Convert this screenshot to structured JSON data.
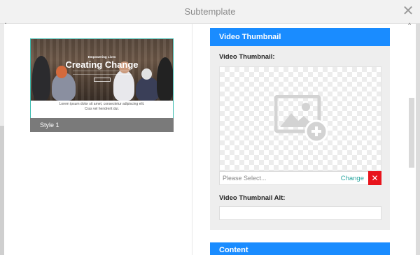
{
  "dialog": {
    "title": "Subtemplate",
    "close_icon": "close-icon"
  },
  "style_card": {
    "hero_kicker": "Empowering Lives",
    "hero_headline": "Creating Change",
    "body_text": "Lorem ipsum dolor sit amet, consectetur adipiscing elit. Cras vel hendrerit dui.",
    "label": "Style 1"
  },
  "video_thumbnail_section": {
    "header": "Video Thumbnail",
    "thumbnail_label": "Video Thumbnail:",
    "placeholder_icon": "image-add-icon",
    "select_placeholder": "Please Select...",
    "change_label": "Change",
    "remove_icon": "remove-icon",
    "alt_label": "Video Thumbnail Alt:",
    "alt_value": ""
  },
  "content_section": {
    "header": "Content"
  },
  "colors": {
    "accent": "#1a8cff",
    "danger": "#e8141c",
    "link": "#2aa6a0",
    "selected_border": "#3dbcb0"
  }
}
